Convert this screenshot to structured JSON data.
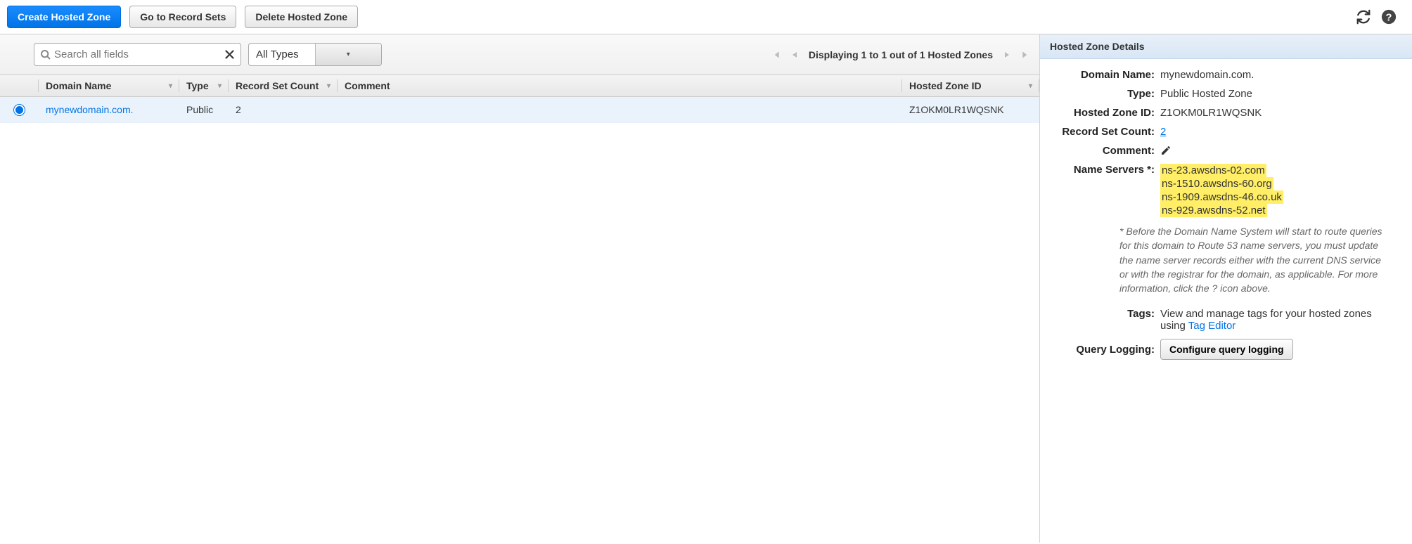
{
  "toolbar": {
    "create_label": "Create Hosted Zone",
    "recordsets_label": "Go to Record Sets",
    "delete_label": "Delete Hosted Zone"
  },
  "search": {
    "placeholder": "Search all fields",
    "type_filter": "All Types",
    "pager_text": "Displaying 1 to 1 out of 1 Hosted Zones"
  },
  "columns": {
    "domain": "Domain Name",
    "type": "Type",
    "count": "Record Set Count",
    "comment": "Comment",
    "zoneid": "Hosted Zone ID"
  },
  "rows": [
    {
      "domain": "mynewdomain.com.",
      "type": "Public",
      "count": "2",
      "comment": "",
      "zoneid": "Z1OKM0LR1WQSNK"
    }
  ],
  "details": {
    "header": "Hosted Zone Details",
    "labels": {
      "domain": "Domain Name:",
      "type": "Type:",
      "zoneid": "Hosted Zone ID:",
      "count": "Record Set Count:",
      "comment": "Comment:",
      "ns": "Name Servers *:",
      "tags": "Tags:",
      "ql": "Query Logging:"
    },
    "values": {
      "domain": "mynewdomain.com.",
      "type": "Public Hosted Zone",
      "zoneid": "Z1OKM0LR1WQSNK",
      "count": "2",
      "ns": [
        "ns-23.awsdns-02.com",
        "ns-1510.awsdns-60.org",
        "ns-1909.awsdns-46.co.uk",
        "ns-929.awsdns-52.net"
      ],
      "tags_text": "View and manage tags for your hosted zones using ",
      "tag_editor_link": "Tag Editor",
      "ql_btn": "Configure query logging"
    },
    "note": "* Before the Domain Name System will start to route queries for this domain to Route 53 name servers, you must update the name server records either with the current DNS service or with the registrar for the domain, as applicable. For more information, click the ? icon above."
  }
}
